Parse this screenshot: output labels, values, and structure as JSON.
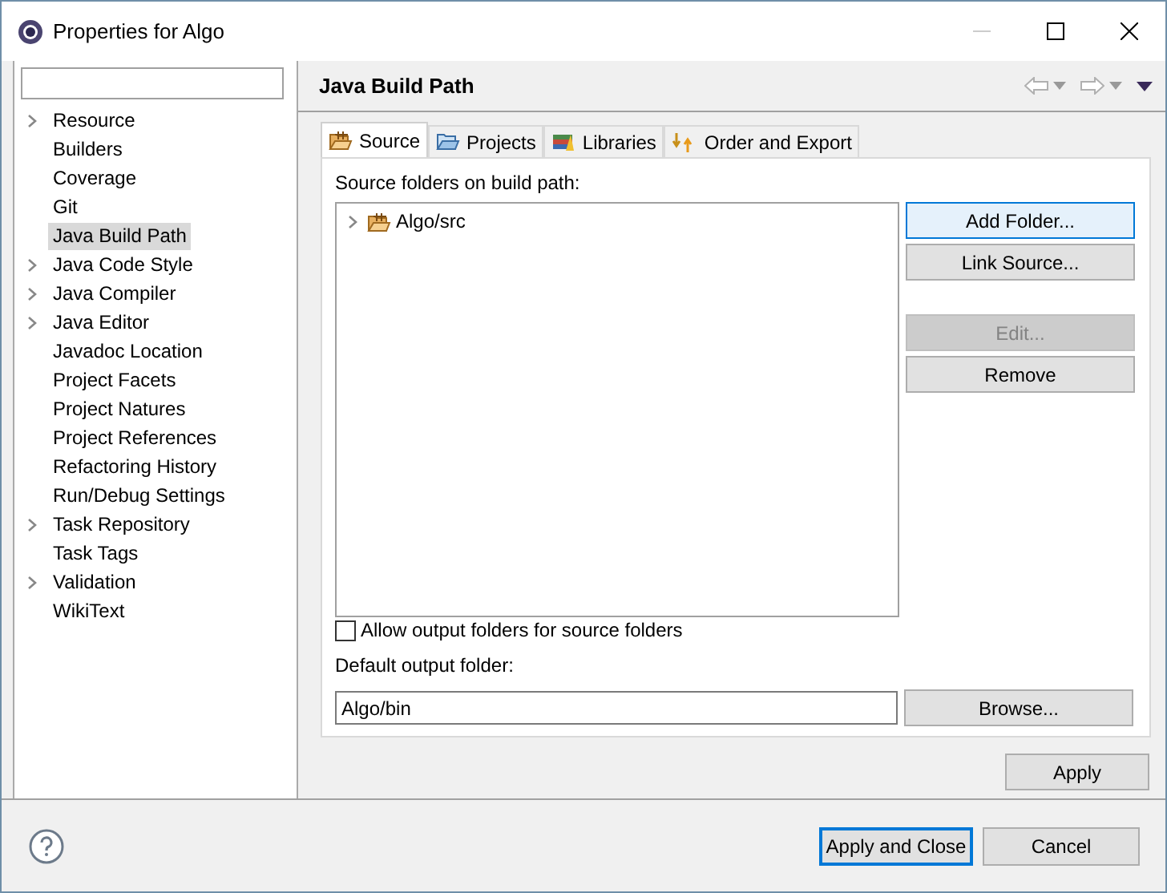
{
  "window": {
    "title": "Properties for Algo"
  },
  "sidebar": {
    "items": [
      {
        "label": "Resource",
        "expandable": true,
        "selected": false
      },
      {
        "label": "Builders",
        "expandable": false,
        "selected": false
      },
      {
        "label": "Coverage",
        "expandable": false,
        "selected": false
      },
      {
        "label": "Git",
        "expandable": false,
        "selected": false
      },
      {
        "label": "Java Build Path",
        "expandable": false,
        "selected": true
      },
      {
        "label": "Java Code Style",
        "expandable": true,
        "selected": false
      },
      {
        "label": "Java Compiler",
        "expandable": true,
        "selected": false
      },
      {
        "label": "Java Editor",
        "expandable": true,
        "selected": false
      },
      {
        "label": "Javadoc Location",
        "expandable": false,
        "selected": false
      },
      {
        "label": "Project Facets",
        "expandable": false,
        "selected": false
      },
      {
        "label": "Project Natures",
        "expandable": false,
        "selected": false
      },
      {
        "label": "Project References",
        "expandable": false,
        "selected": false
      },
      {
        "label": "Refactoring History",
        "expandable": false,
        "selected": false
      },
      {
        "label": "Run/Debug Settings",
        "expandable": false,
        "selected": false
      },
      {
        "label": "Task Repository",
        "expandable": true,
        "selected": false
      },
      {
        "label": "Task Tags",
        "expandable": false,
        "selected": false
      },
      {
        "label": "Validation",
        "expandable": true,
        "selected": false
      },
      {
        "label": "WikiText",
        "expandable": false,
        "selected": false
      }
    ]
  },
  "page": {
    "title": "Java Build Path",
    "tabs": [
      {
        "label": "Source",
        "selected": true
      },
      {
        "label": "Projects",
        "selected": false
      },
      {
        "label": "Libraries",
        "selected": false
      },
      {
        "label": "Order and Export",
        "selected": false
      }
    ],
    "source_label": "Source folders on build path:",
    "tree": [
      {
        "label": "Algo/src",
        "expanded": false
      }
    ],
    "buttons": [
      {
        "label": "Add Folder...",
        "disabled": false,
        "focused": true
      },
      {
        "label": "Link Source...",
        "disabled": false,
        "focused": false
      },
      {
        "label": "Edit...",
        "disabled": true,
        "focused": false
      },
      {
        "label": "Remove",
        "disabled": false,
        "focused": false
      }
    ],
    "allow_output": {
      "label": "Allow output folders for source folders",
      "checked": false
    },
    "output_label": "Default output folder:",
    "output_value": "Algo/bin",
    "browse": "Browse...",
    "apply": "Apply"
  },
  "footer": {
    "buttons": [
      {
        "label": "Apply and Close",
        "focused": true
      },
      {
        "label": "Cancel",
        "focused": false
      }
    ]
  }
}
